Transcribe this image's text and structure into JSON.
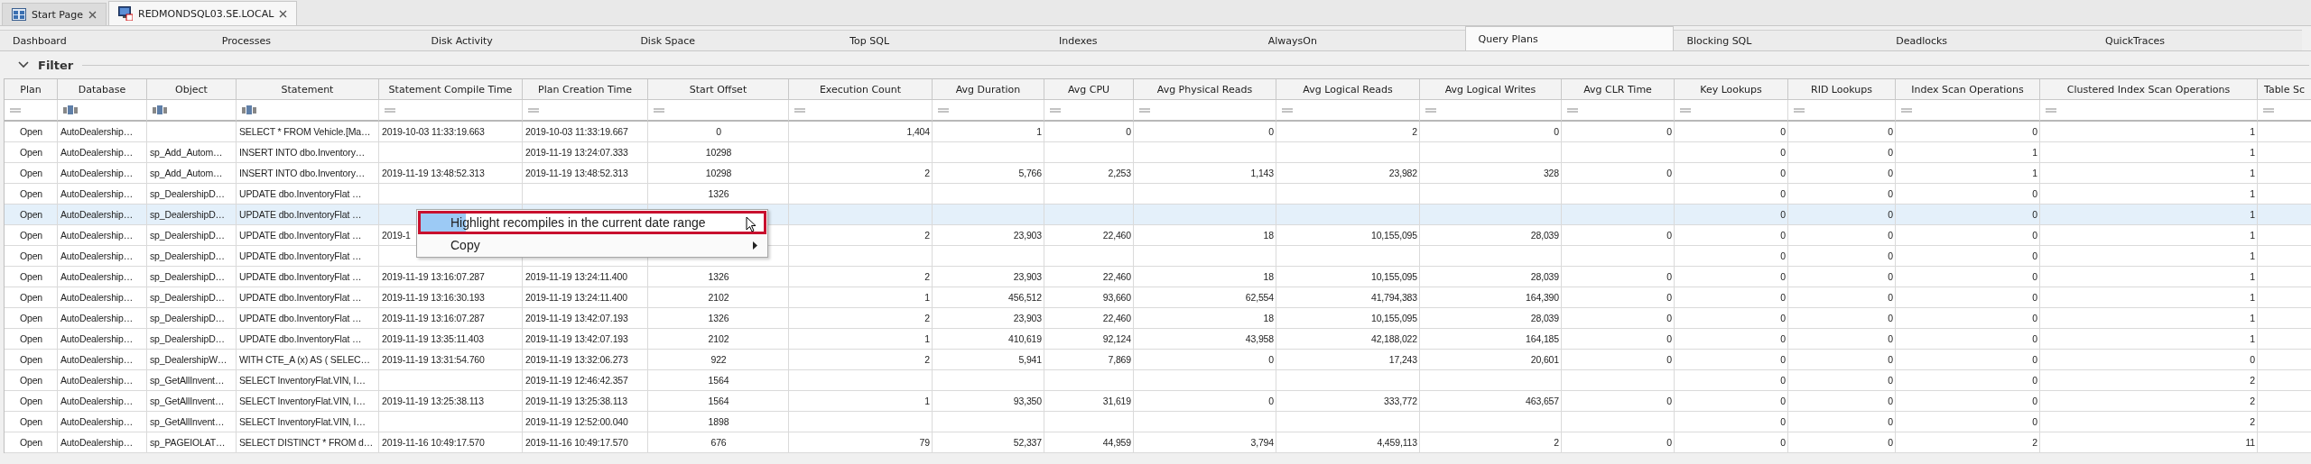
{
  "document_tabs": [
    {
      "label": "Start Page",
      "selected": false
    },
    {
      "label": "REDMONDSQL03.SE.LOCAL",
      "selected": true
    }
  ],
  "nav_tabs": [
    {
      "label": "Dashboard",
      "selected": false
    },
    {
      "label": "Processes",
      "selected": false
    },
    {
      "label": "Disk Activity",
      "selected": false
    },
    {
      "label": "Disk Space",
      "selected": false
    },
    {
      "label": "Top SQL",
      "selected": false
    },
    {
      "label": "Indexes",
      "selected": false
    },
    {
      "label": "AlwaysOn",
      "selected": false
    },
    {
      "label": "Query Plans",
      "selected": true
    },
    {
      "label": "Blocking SQL",
      "selected": false
    },
    {
      "label": "Deadlocks",
      "selected": false
    },
    {
      "label": "QuickTraces",
      "selected": false
    }
  ],
  "filter": {
    "title": "Filter",
    "expanded": true
  },
  "table": {
    "columns": [
      {
        "label": "Plan",
        "kind": "action"
      },
      {
        "label": "Database",
        "kind": "text"
      },
      {
        "label": "Object",
        "kind": "text"
      },
      {
        "label": "Statement",
        "kind": "text"
      },
      {
        "label": "Statement Compile Time",
        "kind": "date"
      },
      {
        "label": "Plan Creation Time",
        "kind": "date"
      },
      {
        "label": "Start Offset",
        "kind": "center"
      },
      {
        "label": "Execution Count",
        "kind": "number"
      },
      {
        "label": "Avg Duration",
        "kind": "number"
      },
      {
        "label": "Avg CPU",
        "kind": "number"
      },
      {
        "label": "Avg Physical Reads",
        "kind": "number"
      },
      {
        "label": "Avg Logical Reads",
        "kind": "number"
      },
      {
        "label": "Avg Logical Writes",
        "kind": "number"
      },
      {
        "label": "Avg CLR Time",
        "kind": "number"
      },
      {
        "label": "Key Lookups",
        "kind": "number"
      },
      {
        "label": "RID Lookups",
        "kind": "number"
      },
      {
        "label": "Index Scan Operations",
        "kind": "number"
      },
      {
        "label": "Clustered Index Scan Operations",
        "kind": "number"
      },
      {
        "label": "Table Sc",
        "kind": "number"
      }
    ],
    "rows": [
      {
        "selected": false,
        "cells": [
          "Open",
          "AutoDealership…",
          "",
          "SELECT * FROM Vehicle.[Ma…",
          "2019-10-03 11:33:19.663",
          "2019-10-03 11:33:19.667",
          "0",
          "1,404",
          "1",
          "0",
          "0",
          "2",
          "0",
          "0",
          "0",
          "0",
          "0",
          "1",
          ""
        ]
      },
      {
        "selected": false,
        "cells": [
          "Open",
          "AutoDealership…",
          "sp_Add_Autom…",
          "INSERT INTO dbo.Inventory…",
          "",
          "2019-11-19 13:24:07.333",
          "10298",
          "",
          "",
          "",
          "",
          "",
          "",
          "",
          "0",
          "0",
          "1",
          "1",
          ""
        ]
      },
      {
        "selected": false,
        "cells": [
          "Open",
          "AutoDealership…",
          "sp_Add_Autom…",
          "INSERT INTO dbo.Inventory…",
          "2019-11-19 13:48:52.313",
          "2019-11-19 13:48:52.313",
          "10298",
          "2",
          "5,766",
          "2,253",
          "1,143",
          "23,982",
          "328",
          "0",
          "0",
          "0",
          "1",
          "1",
          ""
        ]
      },
      {
        "selected": false,
        "cells": [
          "Open",
          "AutoDealership…",
          "sp_DealershipD…",
          "UPDATE dbo.InventoryFlat …",
          "",
          "",
          "1326",
          "",
          "",
          "",
          "",
          "",
          "",
          "",
          "0",
          "0",
          "0",
          "1",
          ""
        ]
      },
      {
        "selected": true,
        "cells": [
          "Open",
          "AutoDealership…",
          "sp_DealershipD…",
          "UPDATE dbo.InventoryFlat …",
          "",
          "",
          "",
          "",
          "",
          "",
          "",
          "",
          "",
          "",
          "0",
          "0",
          "0",
          "1",
          ""
        ]
      },
      {
        "selected": false,
        "cells": [
          "Open",
          "AutoDealership…",
          "sp_DealershipD…",
          "UPDATE dbo.InventoryFlat …",
          "2019-1",
          "",
          "",
          "2",
          "23,903",
          "22,460",
          "18",
          "10,155,095",
          "28,039",
          "0",
          "0",
          "0",
          "0",
          "1",
          ""
        ]
      },
      {
        "selected": false,
        "cells": [
          "Open",
          "AutoDealership…",
          "sp_DealershipD…",
          "UPDATE dbo.InventoryFlat …",
          "",
          "",
          "",
          "",
          "",
          "",
          "",
          "",
          "",
          "",
          "0",
          "0",
          "0",
          "1",
          ""
        ]
      },
      {
        "selected": false,
        "cells": [
          "Open",
          "AutoDealership…",
          "sp_DealershipD…",
          "UPDATE dbo.InventoryFlat …",
          "2019-11-19 13:16:07.287",
          "2019-11-19 13:24:11.400",
          "1326",
          "2",
          "23,903",
          "22,460",
          "18",
          "10,155,095",
          "28,039",
          "0",
          "0",
          "0",
          "0",
          "1",
          ""
        ]
      },
      {
        "selected": false,
        "cells": [
          "Open",
          "AutoDealership…",
          "sp_DealershipD…",
          "UPDATE dbo.InventoryFlat …",
          "2019-11-19 13:16:30.193",
          "2019-11-19 13:24:11.400",
          "2102",
          "1",
          "456,512",
          "93,660",
          "62,554",
          "41,794,383",
          "164,390",
          "0",
          "0",
          "0",
          "0",
          "1",
          ""
        ]
      },
      {
        "selected": false,
        "cells": [
          "Open",
          "AutoDealership…",
          "sp_DealershipD…",
          "UPDATE dbo.InventoryFlat …",
          "2019-11-19 13:16:07.287",
          "2019-11-19 13:42:07.193",
          "1326",
          "2",
          "23,903",
          "22,460",
          "18",
          "10,155,095",
          "28,039",
          "0",
          "0",
          "0",
          "0",
          "1",
          ""
        ]
      },
      {
        "selected": false,
        "cells": [
          "Open",
          "AutoDealership…",
          "sp_DealershipD…",
          "UPDATE dbo.InventoryFlat …",
          "2019-11-19 13:35:11.403",
          "2019-11-19 13:42:07.193",
          "2102",
          "1",
          "410,619",
          "92,124",
          "43,958",
          "42,188,022",
          "164,185",
          "0",
          "0",
          "0",
          "0",
          "1",
          ""
        ]
      },
      {
        "selected": false,
        "cells": [
          "Open",
          "AutoDealership…",
          "sp_DealershipW…",
          "WITH CTE_A (x) AS ( SELEC…",
          "2019-11-19 13:31:54.760",
          "2019-11-19 13:32:06.273",
          "922",
          "2",
          "5,941",
          "7,869",
          "0",
          "17,243",
          "20,601",
          "0",
          "0",
          "0",
          "0",
          "0",
          ""
        ]
      },
      {
        "selected": false,
        "cells": [
          "Open",
          "AutoDealership…",
          "sp_GetAllInvent…",
          "SELECT InventoryFlat.VIN, I…",
          "",
          "2019-11-19 12:46:42.357",
          "1564",
          "",
          "",
          "",
          "",
          "",
          "",
          "",
          "0",
          "0",
          "0",
          "2",
          ""
        ]
      },
      {
        "selected": false,
        "cells": [
          "Open",
          "AutoDealership…",
          "sp_GetAllInvent…",
          "SELECT InventoryFlat.VIN, I…",
          "2019-11-19 13:25:38.113",
          "2019-11-19 13:25:38.113",
          "1564",
          "1",
          "93,350",
          "31,619",
          "0",
          "333,772",
          "463,657",
          "0",
          "0",
          "0",
          "0",
          "2",
          ""
        ]
      },
      {
        "selected": false,
        "cells": [
          "Open",
          "AutoDealership…",
          "sp_GetAllInvent…",
          "SELECT InventoryFlat.VIN, I…",
          "",
          "2019-11-19 12:52:00.040",
          "1898",
          "",
          "",
          "",
          "",
          "",
          "",
          "",
          "0",
          "0",
          "0",
          "2",
          ""
        ]
      },
      {
        "selected": false,
        "cells": [
          "Open",
          "AutoDealership…",
          "sp_PAGEIOLAT…",
          "SELECT DISTINCT * FROM d…",
          "2019-11-16 10:49:17.570",
          "2019-11-16 10:49:17.570",
          "676",
          "79",
          "52,337",
          "44,959",
          "3,794",
          "4,459,113",
          "2",
          "0",
          "0",
          "0",
          "2",
          "11",
          ""
        ]
      }
    ]
  },
  "context_menu": {
    "items": [
      {
        "label": "Highlight recompiles in the current date range",
        "highlighted": true,
        "submenu": false
      },
      {
        "label": "Copy",
        "highlighted": false,
        "submenu": true
      }
    ]
  }
}
